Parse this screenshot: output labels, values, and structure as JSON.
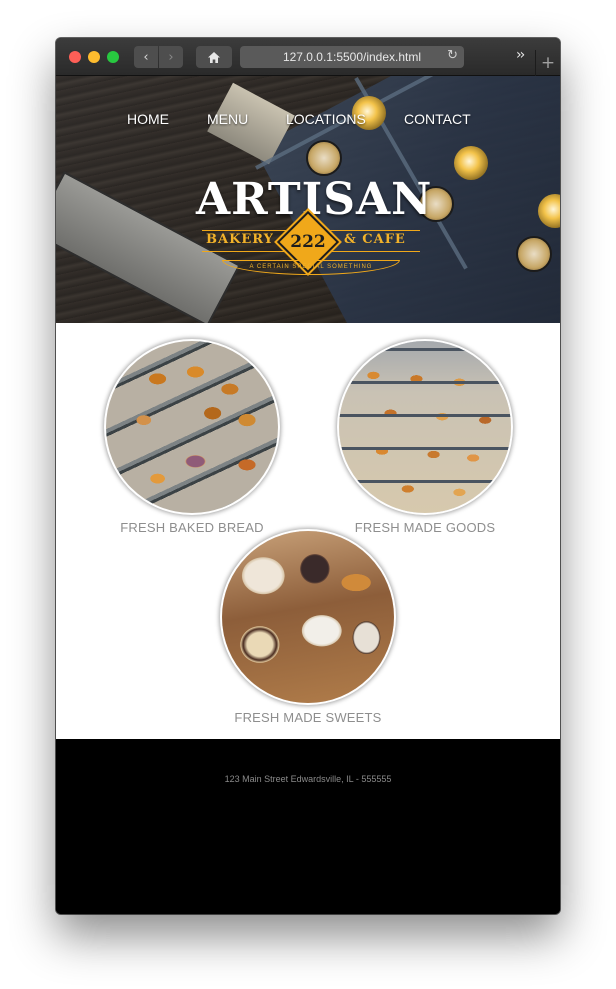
{
  "browser": {
    "url": "127.0.0.1:5500/index.html",
    "icons": {
      "back": "chevron-left-icon",
      "forward": "chevron-right-icon",
      "home": "home-icon",
      "reload": "reload-icon",
      "overflow": "double-chevron-right-icon",
      "new_tab": "plus-icon"
    },
    "colors": {
      "close": "#fe5f57",
      "minimize": "#febc2e",
      "zoom": "#28c840"
    }
  },
  "nav": {
    "items": [
      {
        "label": "HOME"
      },
      {
        "label": "MENU"
      },
      {
        "label": "LOCATIONS"
      },
      {
        "label": "CONTACT"
      }
    ]
  },
  "logo": {
    "title": "ARTISAN",
    "left": "BAKERY",
    "number": "222",
    "right": "& CAFE",
    "tagline": "A CERTAIN SPECIAL SOMETHING",
    "accent": "#f0a81a"
  },
  "features": [
    {
      "label": "FRESH BAKED BREAD",
      "image": "pastry-trays-photo"
    },
    {
      "label": "FRESH MADE GOODS",
      "image": "display-case-photo"
    },
    {
      "label": "FRESH MADE SWEETS",
      "image": "sweets-board-photo"
    }
  ],
  "footer": {
    "address": "123 Main Street Edwardsville, IL - 555555"
  }
}
